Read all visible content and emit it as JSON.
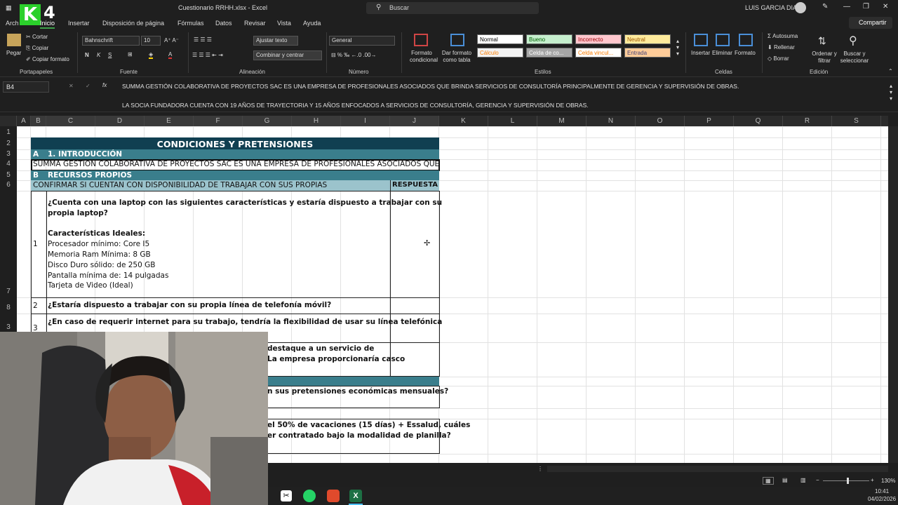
{
  "titlebar": {
    "filename": "Cuestionario RRHH.xlsx  -  Excel",
    "search_placeholder": "Buscar",
    "user": "LUIS GARCIA DIAZ"
  },
  "logo": {
    "k": "K",
    "num": "4"
  },
  "tabs": [
    "Archivo",
    "Inicio",
    "Insertar",
    "Disposición de página",
    "Fórmulas",
    "Datos",
    "Revisar",
    "Vista",
    "Ayuda"
  ],
  "tabs_visible": [
    "Arch",
    "Inicio",
    "Insertar",
    "Disposición de página",
    "Fórmulas",
    "Datos",
    "Revisar",
    "Vista",
    "Ayuda"
  ],
  "share": "Compartir",
  "ribbon": {
    "clipboard": {
      "paste": "Pegar",
      "cut": "Cortar",
      "copy": "Copiar",
      "format_painter": "Copiar formato",
      "group": "Portapapeles"
    },
    "font": {
      "name": "Bahnschrift",
      "size": "10",
      "bold": "N",
      "italic": "K",
      "underline": "S",
      "group": "Fuente"
    },
    "alignment": {
      "wrap": "Ajustar texto",
      "merge": "Combinar y centrar",
      "group": "Alineación"
    },
    "number": {
      "format": "General",
      "group": "Número"
    },
    "styles": {
      "cond_format": "Formato condicional",
      "table_format": "Dar formato como tabla",
      "group": "Estilos",
      "items": [
        {
          "label": "Normal",
          "bg": "#ffffff",
          "fg": "#000000"
        },
        {
          "label": "Bueno",
          "bg": "#c6efce",
          "fg": "#006100"
        },
        {
          "label": "Incorrecto",
          "bg": "#ffc7ce",
          "fg": "#9c0006"
        },
        {
          "label": "Neutral",
          "bg": "#ffeb9c",
          "fg": "#9c5700"
        },
        {
          "label": "Cálculo",
          "bg": "#f2f2f2",
          "fg": "#fa7d00"
        },
        {
          "label": "Celda de co...",
          "bg": "#a5a5a5",
          "fg": "#ffffff"
        },
        {
          "label": "Celda vincul...",
          "bg": "#ffffff",
          "fg": "#fa7d00"
        },
        {
          "label": "Entrada",
          "bg": "#ffcc99",
          "fg": "#3f3f76"
        }
      ]
    },
    "cells": {
      "insert": "Insertar",
      "delete": "Eliminar",
      "format": "Formato",
      "group": "Celdas"
    },
    "editing": {
      "autosum": "Autosuma",
      "fill": "Rellenar",
      "clear": "Borrar",
      "sort": "Ordenar y filtrar",
      "find": "Buscar y seleccionar",
      "group": "Edición"
    }
  },
  "formula_bar": {
    "cell_ref": "B4",
    "fx": "fx",
    "line1": "SUMMA GESTIÓN COLABORATIVA DE PROYECTOS SAC ES UNA EMPRESA DE PROFESIONALES ASOCIADOS QUE BRINDA SERVICIOS DE CONSULTORÍA PRINCIPALMENTE DE GERENCIA Y SUPERVISIÓN DE OBRAS.",
    "line2": "LA SOCIA FUNDADORA CUENTA CON 19 AÑOS DE TRAYECTORIA Y 15 AÑOS ENFOCADOS A SERVICIOS DE CONSULTORÍA, GERENCIA Y SUPERVISIÓN DE OBRAS."
  },
  "columns": [
    "A",
    "B",
    "C",
    "D",
    "E",
    "F",
    "G",
    "H",
    "I",
    "J",
    "K",
    "L",
    "M",
    "N",
    "O",
    "P",
    "Q",
    "R",
    "S"
  ],
  "rows": [
    "1",
    "2",
    "3",
    "4",
    "5",
    "6",
    "7",
    "8",
    "3"
  ],
  "sheet": {
    "title": "CONDICIONES Y PRETENSIONES",
    "sec_a_letter": "A",
    "sec_a_title": "1. INTRODUCCIÓN",
    "intro_text": "SUMMA GESTIÓN COLABORATIVA DE PROYECTOS SAC ES UNA EMPRESA DE PROFESIONALES ASOCIADOS QUE",
    "sec_b_letter": "B",
    "sec_b_title": "RECURSOS PROPIOS",
    "confirm_text": "CONFIRMAR SI CUENTAN CON DISPONIBILIDAD DE TRABAJAR CON SUS PROPIAS",
    "respuesta": "RESPUESTA",
    "q1_num": "1",
    "q1_lines": [
      "¿Cuenta con una laptop con las siguientes características y estaría dispuesto a trabajar con su",
      "propia laptop?",
      "",
      "Características Ideales:",
      "Procesador mínimo: Core I5",
      "Memoria Ram Mínima: 8 GB",
      "Disco Duro sólido: de 250 GB",
      "Pantalla mínima de: 14 pulgadas",
      "Tarjeta de Video (Ideal)"
    ],
    "q2_num": "2",
    "q2": "¿Estaría dispuesto a trabajar con su propia línea de telefonía móvil?",
    "q3_num": "3",
    "q3_line1": "¿En caso de requerir internet para su trabajo, tendría la flexibilidad de usar su línea telefónica",
    "q4_partial1": "destaque a un servicio de",
    "q4_partial2": "La empresa proporcionaría casco",
    "q5_partial": "n sus pretensiones económicas mensuales?",
    "q6_partial1": "el 50% de vacaciones (15 días) + Essalud, cuáles",
    "q6_partial2": "er contratado bajo la modalidad de planilla?"
  },
  "status": {
    "zoom": "130%",
    "time": "10:41",
    "date": "04/02/2026"
  }
}
